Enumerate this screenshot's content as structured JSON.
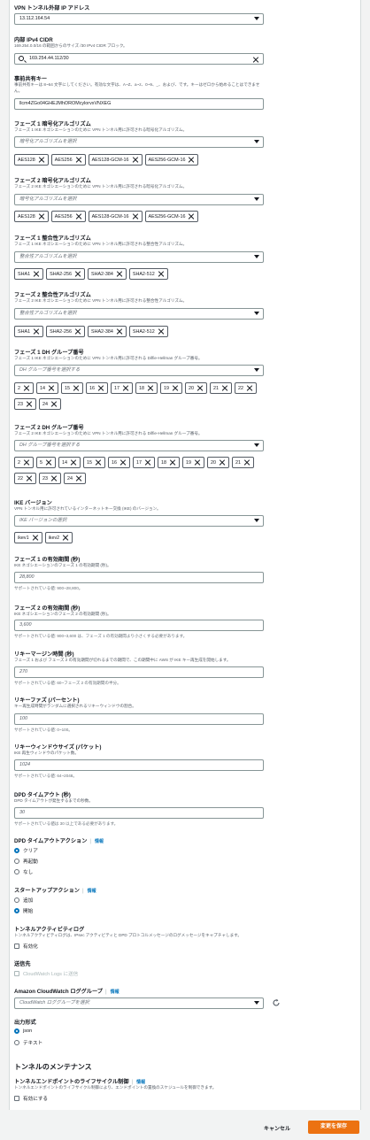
{
  "outside_ip": {
    "label": "VPN トンネル外部 IP アドレス",
    "value": "13.112.164.54"
  },
  "inside_cidr": {
    "label": "内部 IPv4 CIDR",
    "desc": "169.254.0.0/16 の範囲からのサイズ /30 IPv4 CIDR ブロック。",
    "value": "169.254.44.112/30"
  },
  "psk": {
    "label": "事前共有キー",
    "desc1": "事前共有キーは 8~64 文字にしてください。有効な文字は、A~Z、a~z、0~9、_、および、です。キーはゼロから始めることはできませ",
    "desc2": "ん。",
    "value": "llcm4ZGo04GHEJMhOROMcylorvxVNXEG"
  },
  "p1_enc": {
    "label": "フェーズ 1 暗号化アルゴリズム",
    "desc": "フェーズ 1 IKE ネゴシエーションのために VPN トンネル用に許可される暗号化アルゴリズム。",
    "placeholder": "暗号化アルゴリズムを選択",
    "tokens": [
      "AES128",
      "AES256",
      "AES128-GCM-16",
      "AES256-GCM-16"
    ]
  },
  "p2_enc": {
    "label": "フェーズ 2 暗号化アルゴリズム",
    "desc": "フェーズ 2 IKE ネゴシエーションのために VPN トンネル用に許可される暗号化アルゴリズム。",
    "placeholder": "暗号化アルゴリズムを選択",
    "tokens": [
      "AES128",
      "AES256",
      "AES128-GCM-16",
      "AES256-GCM-16"
    ]
  },
  "p1_int": {
    "label": "フェーズ 1 整合性アルゴリズム",
    "desc": "フェーズ 1 IKE ネゴシエーションのために VPN トンネル用に許可される整合性アルゴリズム。",
    "placeholder": "整合性アルゴリズムを選択",
    "tokens": [
      "SHA1",
      "SHA2-256",
      "SHA2-384",
      "SHA2-512"
    ]
  },
  "p2_int": {
    "label": "フェーズ 2 整合性アルゴリズム",
    "desc": "フェーズ 2 IKE ネゴシエーションのために VPN トンネル用に許可される整合性アルゴリズム。",
    "placeholder": "整合性アルゴリズムを選択",
    "tokens": [
      "SHA1",
      "SHA2-256",
      "SHA2-384",
      "SHA2-512"
    ]
  },
  "p1_dh": {
    "label": "フェーズ 1 DH グループ番号",
    "desc": "フェーズ 1 IKE ネゴシエーションのために VPN トンネル用に許可される Diffie-Hellman グループ番号。",
    "placeholder": "DH グループ番号を選択する",
    "tokens": [
      "2",
      "14",
      "15",
      "16",
      "17",
      "18",
      "19",
      "20",
      "21",
      "22",
      "23",
      "24"
    ]
  },
  "p2_dh": {
    "label": "フェーズ 2 DH グループ番号",
    "desc": "フェーズ 2 IKE ネゴシエーションのために VPN トンネル用に許可される Diffie-Hellman グループ番号。",
    "placeholder": "DH グループ番号を選択する",
    "tokens": [
      "2",
      "5",
      "14",
      "15",
      "16",
      "17",
      "18",
      "19",
      "20",
      "21",
      "22",
      "23",
      "24"
    ]
  },
  "ike": {
    "label": "IKE バージョン",
    "desc": "VPN トンネル用に許可されているインターネットキー交換 (IKE) のバージョン。",
    "placeholder": "IKE バージョンの選択",
    "tokens": [
      "ikev1",
      "ikev2"
    ]
  },
  "p1_life": {
    "label": "フェーズ 1 の有効期間 (秒)",
    "desc": "IKE ネゴシエーションのフェーズ 1 の有効期間 (秒)。",
    "value": "28,800",
    "hint": "サポートされている値: 900~28,800。"
  },
  "p2_life": {
    "label": "フェーズ 2 の有効期間 (秒)",
    "desc": "IKE ネゴシエーションのフェーズ 2 の有効期間 (秒)。",
    "value": "3,600",
    "hint": "サポートされている値: 900~3,600 は、フェーズ 1 の有効期間より小さくする必要があります。"
  },
  "rekey_margin": {
    "label": "リキーマージン時間 (秒)",
    "desc": "フェーズ 1 および フェーズ 2 の有効期間が切れるまでの期間で、この期間中に AWS が IKE キー再生成を開始します。",
    "value": "270",
    "hint": "サポートされている値: 60~フェーズ 2 の有効期間の半分。"
  },
  "rekey_fuzz": {
    "label": "リキーファズ (パーセント)",
    "desc": "キー再生成時間がランダムに選択されるリキーウィンドウの割合。",
    "value": "100",
    "hint": "サポートされている値: 0~100。"
  },
  "replay": {
    "label": "リキーウィンドウサイズ (パケット)",
    "desc": "IKE 再生ウィンドウのパケット数。",
    "value": "1024",
    "hint": "サポートされている値: 64~2048。"
  },
  "dpd_timeout": {
    "label": "DPD タイムアウト (秒)",
    "desc": "DPD タイムアウトが発生するまでの秒数。",
    "value": "30",
    "hint": "サポートされている値は 30 以上である必要があります。"
  },
  "dpd_action": {
    "label": "DPD タイムアウトアクション",
    "info": "情報",
    "options": [
      "クリア",
      "再起動",
      "なし"
    ]
  },
  "startup": {
    "label": "スタートアップアクション",
    "info": "情報",
    "options": [
      "追加",
      "開始"
    ]
  },
  "activity": {
    "label": "トンネルアクティビティログ",
    "desc": "トンネルアクティビティログは、IPsec アクティビティと DPD プロトコルメッセージのログメッセージをキャプチャします。",
    "checkbox": "有効化"
  },
  "dest": {
    "label": "送信先",
    "checkbox": "CloudWatch Logs に送信"
  },
  "loggroup": {
    "label": "Amazon CloudWatch ロググループ",
    "info": "情報",
    "placeholder": "CloudWatch ロググループを選択"
  },
  "format": {
    "label": "出力形式",
    "options": [
      "json",
      "テキスト"
    ]
  },
  "maintenance": {
    "title": "トンネルのメンテナンス",
    "label": "トンネルエンドポイントのライフサイクル制御",
    "info": "情報",
    "desc": "トンネルエンドポイントのライフサイクル制御により、エンドポイントの置換のスケジュールを制御できます。",
    "checkbox": "有効にする"
  },
  "footer": {
    "cancel": "キャンセル",
    "save": "変更を保存"
  },
  "colors": {
    "primary": "#ec7211",
    "link": "#0073bb"
  }
}
